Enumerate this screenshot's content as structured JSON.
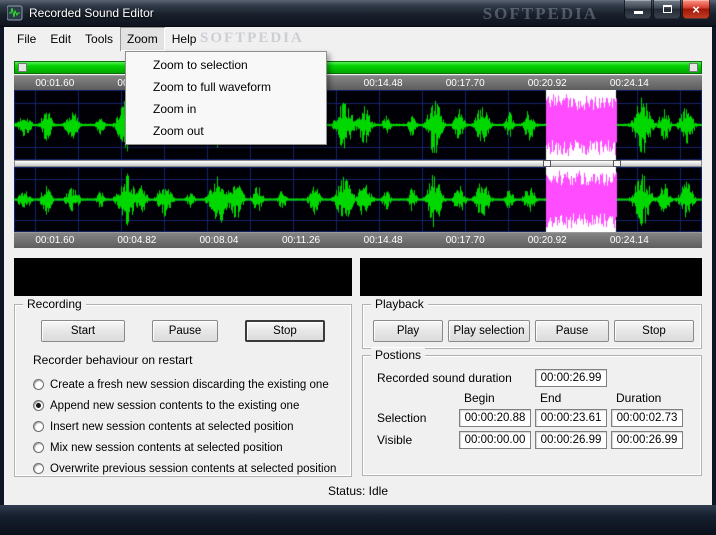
{
  "window": {
    "title": "Recorded Sound Editor",
    "watermark": "SOFTPEDIA",
    "watermark2": "SOFTPEDIA",
    "close_glyph": "×",
    "icons": {
      "app": "waveform-app-icon",
      "minimize": "minimize-icon",
      "maximize": "maximize-icon",
      "close": "close-icon"
    }
  },
  "menu": {
    "items": [
      "File",
      "Edit",
      "Tools",
      "Zoom",
      "Help"
    ],
    "open_item": "Zoom",
    "dropdown": [
      "Zoom to selection",
      "Zoom to full waveform",
      "Zoom in",
      "Zoom out"
    ]
  },
  "waveform": {
    "ruler_labels": [
      "00:01.60",
      "00:04.82",
      "00:08.04",
      "00:11.26",
      "00:14.48",
      "00:17.70",
      "00:20.92",
      "00:24.14"
    ],
    "tick_fracs": [
      0.0593,
      0.1786,
      0.2979,
      0.4172,
      0.5365,
      0.6558,
      0.7751,
      0.8944
    ],
    "selection_start_frac": 0.7736,
    "selection_end_frac": 0.8748,
    "colors": {
      "background": "#000006",
      "grid": "#16246a",
      "wave": "#00d800",
      "selection_bg": "#ffffff",
      "selection_wave": "#ff4cff"
    }
  },
  "recording": {
    "title": "Recording",
    "buttons": [
      "Start",
      "Pause",
      "Stop"
    ],
    "behaviour_label": "Recorder behaviour on restart",
    "options": [
      "Create a fresh new session discarding the existing one",
      "Append new session contents to the existing one",
      "Insert new session contents at selected position",
      "Mix new session contents at selected position",
      "Overwrite previous session contents at selected position"
    ],
    "selected_option": 1
  },
  "playback": {
    "title": "Playback",
    "buttons": [
      "Play",
      "Play selection",
      "Pause",
      "Stop"
    ]
  },
  "positions": {
    "title": "Postions",
    "duration_label": "Recorded sound duration",
    "duration_value": "00:00:26.99",
    "headers": [
      "Begin",
      "End",
      "Duration"
    ],
    "rows": [
      {
        "label": "Selection",
        "begin": "00:00:20.88",
        "end": "00:00:23.61",
        "duration": "00:00:02.73"
      },
      {
        "label": "Visible",
        "begin": "00:00:00.00",
        "end": "00:00:26.99",
        "duration": "00:00:26.99"
      }
    ]
  },
  "status": "Status: Idle"
}
